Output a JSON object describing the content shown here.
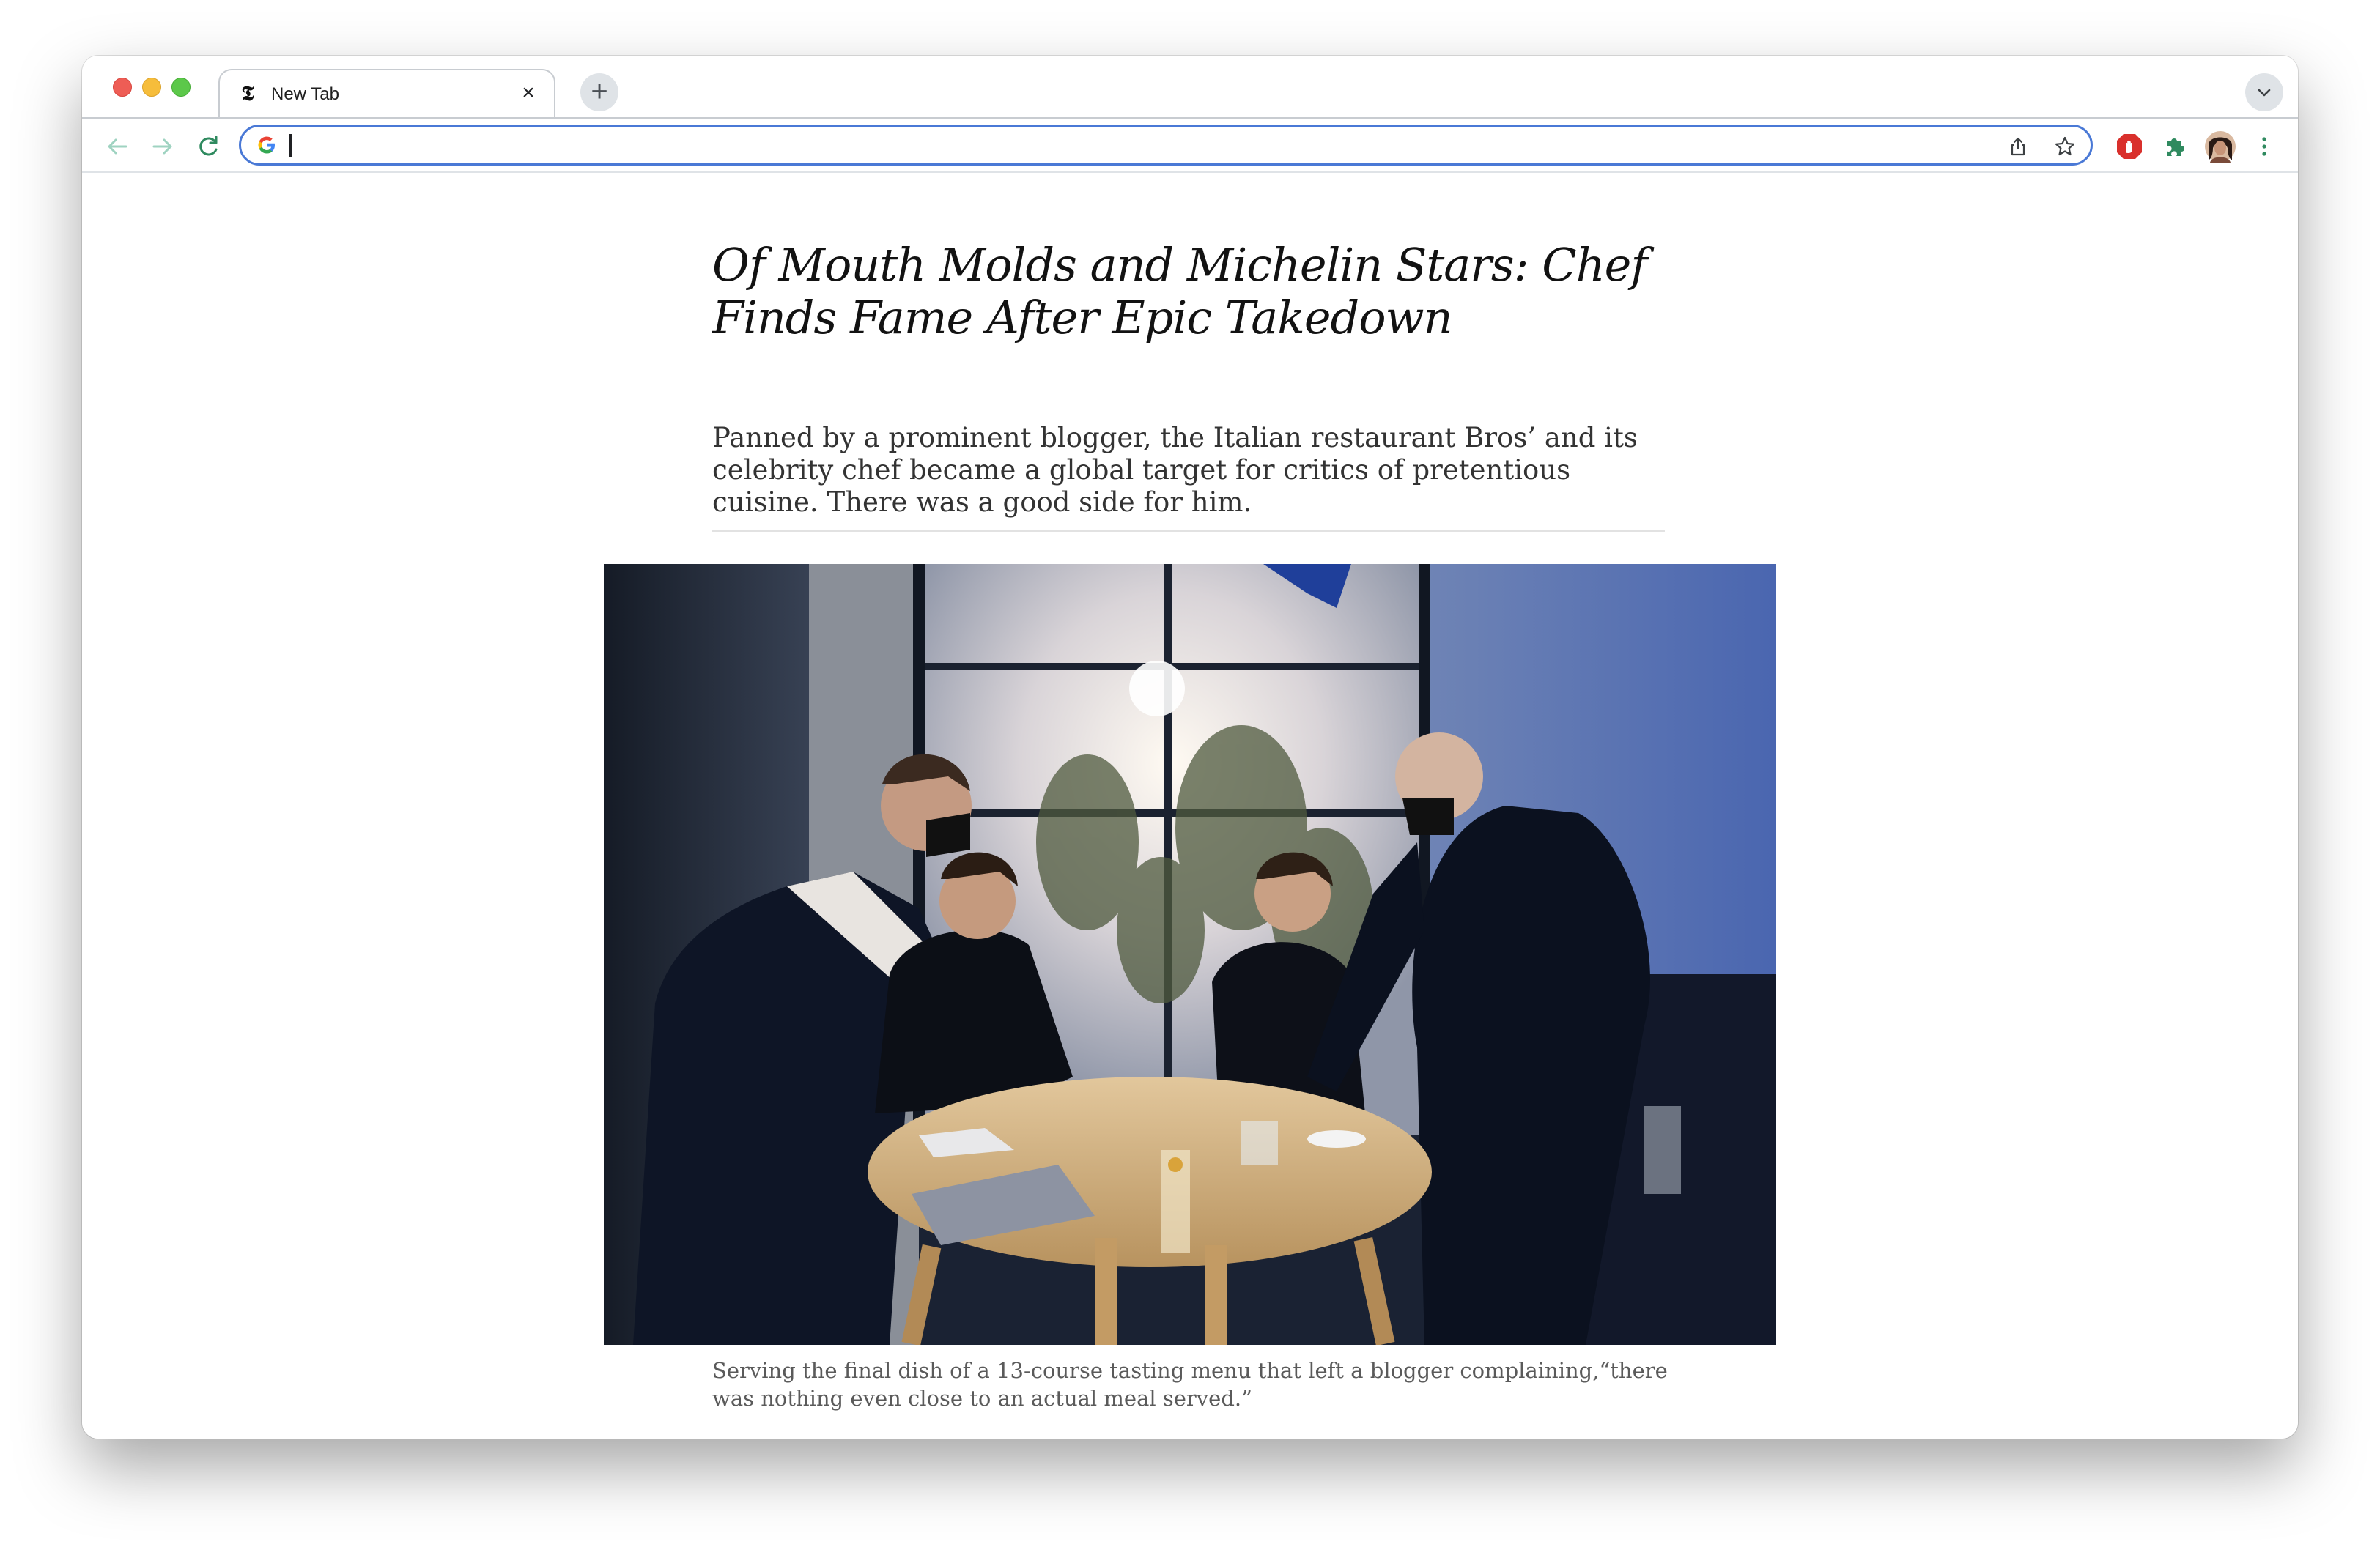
{
  "browser": {
    "tab": {
      "title": "New Tab",
      "favicon": "nyt-logo",
      "close_icon": "close-icon"
    },
    "new_tab_icon": "plus-icon",
    "tab_search_icon": "chevron-down-icon",
    "nav": {
      "back_icon": "arrow-left-icon",
      "forward_icon": "arrow-right-icon",
      "reload_icon": "reload-icon"
    },
    "omnibox": {
      "value": "",
      "engine_icon": "google-g-icon",
      "share_icon": "share-icon",
      "bookmark_icon": "star-icon"
    },
    "extensions": {
      "adblock_icon": "adblock-icon",
      "puzzle_icon": "puzzle-icon",
      "profile_icon": "avatar",
      "menu_icon": "kebab-menu-icon"
    },
    "colors": {
      "omnibox_border": "#4a79d6",
      "traffic_red": "#ee5d55",
      "traffic_yellow": "#f6bd3b",
      "traffic_green": "#5cc84a",
      "nav_arrows": "#8fc7b3",
      "reload": "#2f8a5f"
    }
  },
  "article": {
    "headline": "Of Mouth Molds and Michelin Stars: Chef Finds Fame After Epic Takedown",
    "summary": "Panned by a prominent blogger, the Italian restaurant Bros’ and its celebrity chef became a global target for critics of pretentious cuisine. There was a good side for him.",
    "photo_caption": "Serving the final dish of a 13-course tasting menu that left a blogger complaining,“there was nothing even close to an actual meal served.”"
  }
}
